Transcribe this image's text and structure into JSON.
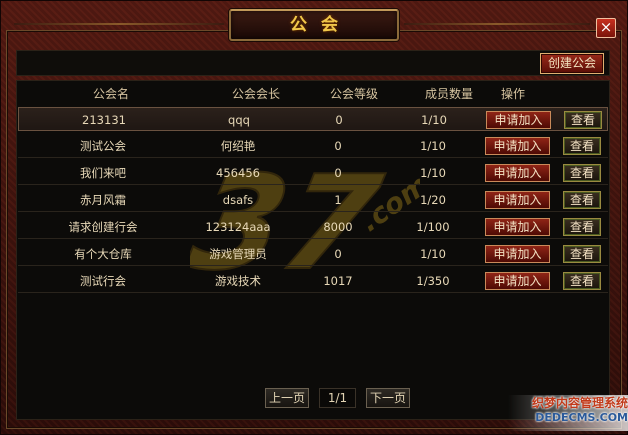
{
  "window": {
    "title": "公会",
    "close_label": "×"
  },
  "toolbar": {
    "create_label": "创建公会"
  },
  "table": {
    "headers": {
      "name": "公会名",
      "leader": "公会会长",
      "level": "公会等级",
      "members": "成员数量",
      "ops": "操作"
    },
    "apply_label": "申请加入",
    "view_label": "查看",
    "rows": [
      {
        "name": "213131",
        "leader": "qqq",
        "level": "0",
        "members": "1/10"
      },
      {
        "name": "测试公会",
        "leader": "何绍艳",
        "level": "0",
        "members": "1/10"
      },
      {
        "name": "我们来吧",
        "leader": "456456",
        "level": "0",
        "members": "1/10"
      },
      {
        "name": "赤月风霜",
        "leader": "dsafs",
        "level": "1",
        "members": "1/20"
      },
      {
        "name": "请求创建行会",
        "leader": "123124aaa",
        "level": "8000",
        "members": "1/100"
      },
      {
        "name": "有个大仓库",
        "leader": "游戏管理员",
        "level": "0",
        "members": "1/10"
      },
      {
        "name": "测试行会",
        "leader": "游戏技术",
        "level": "1017",
        "members": "1/350"
      }
    ]
  },
  "pager": {
    "prev_label": "上一页",
    "page_text": "1/1",
    "next_label": "下一页"
  },
  "watermark": {
    "text": "37",
    "suffix": ".com"
  },
  "corner": {
    "line1": "织梦内容管理系统",
    "line2": "DEDECMS.COM"
  },
  "colors": {
    "title": "#f2c84a",
    "button_red": "#8f2416",
    "panel_bg": "#0c0b09"
  }
}
